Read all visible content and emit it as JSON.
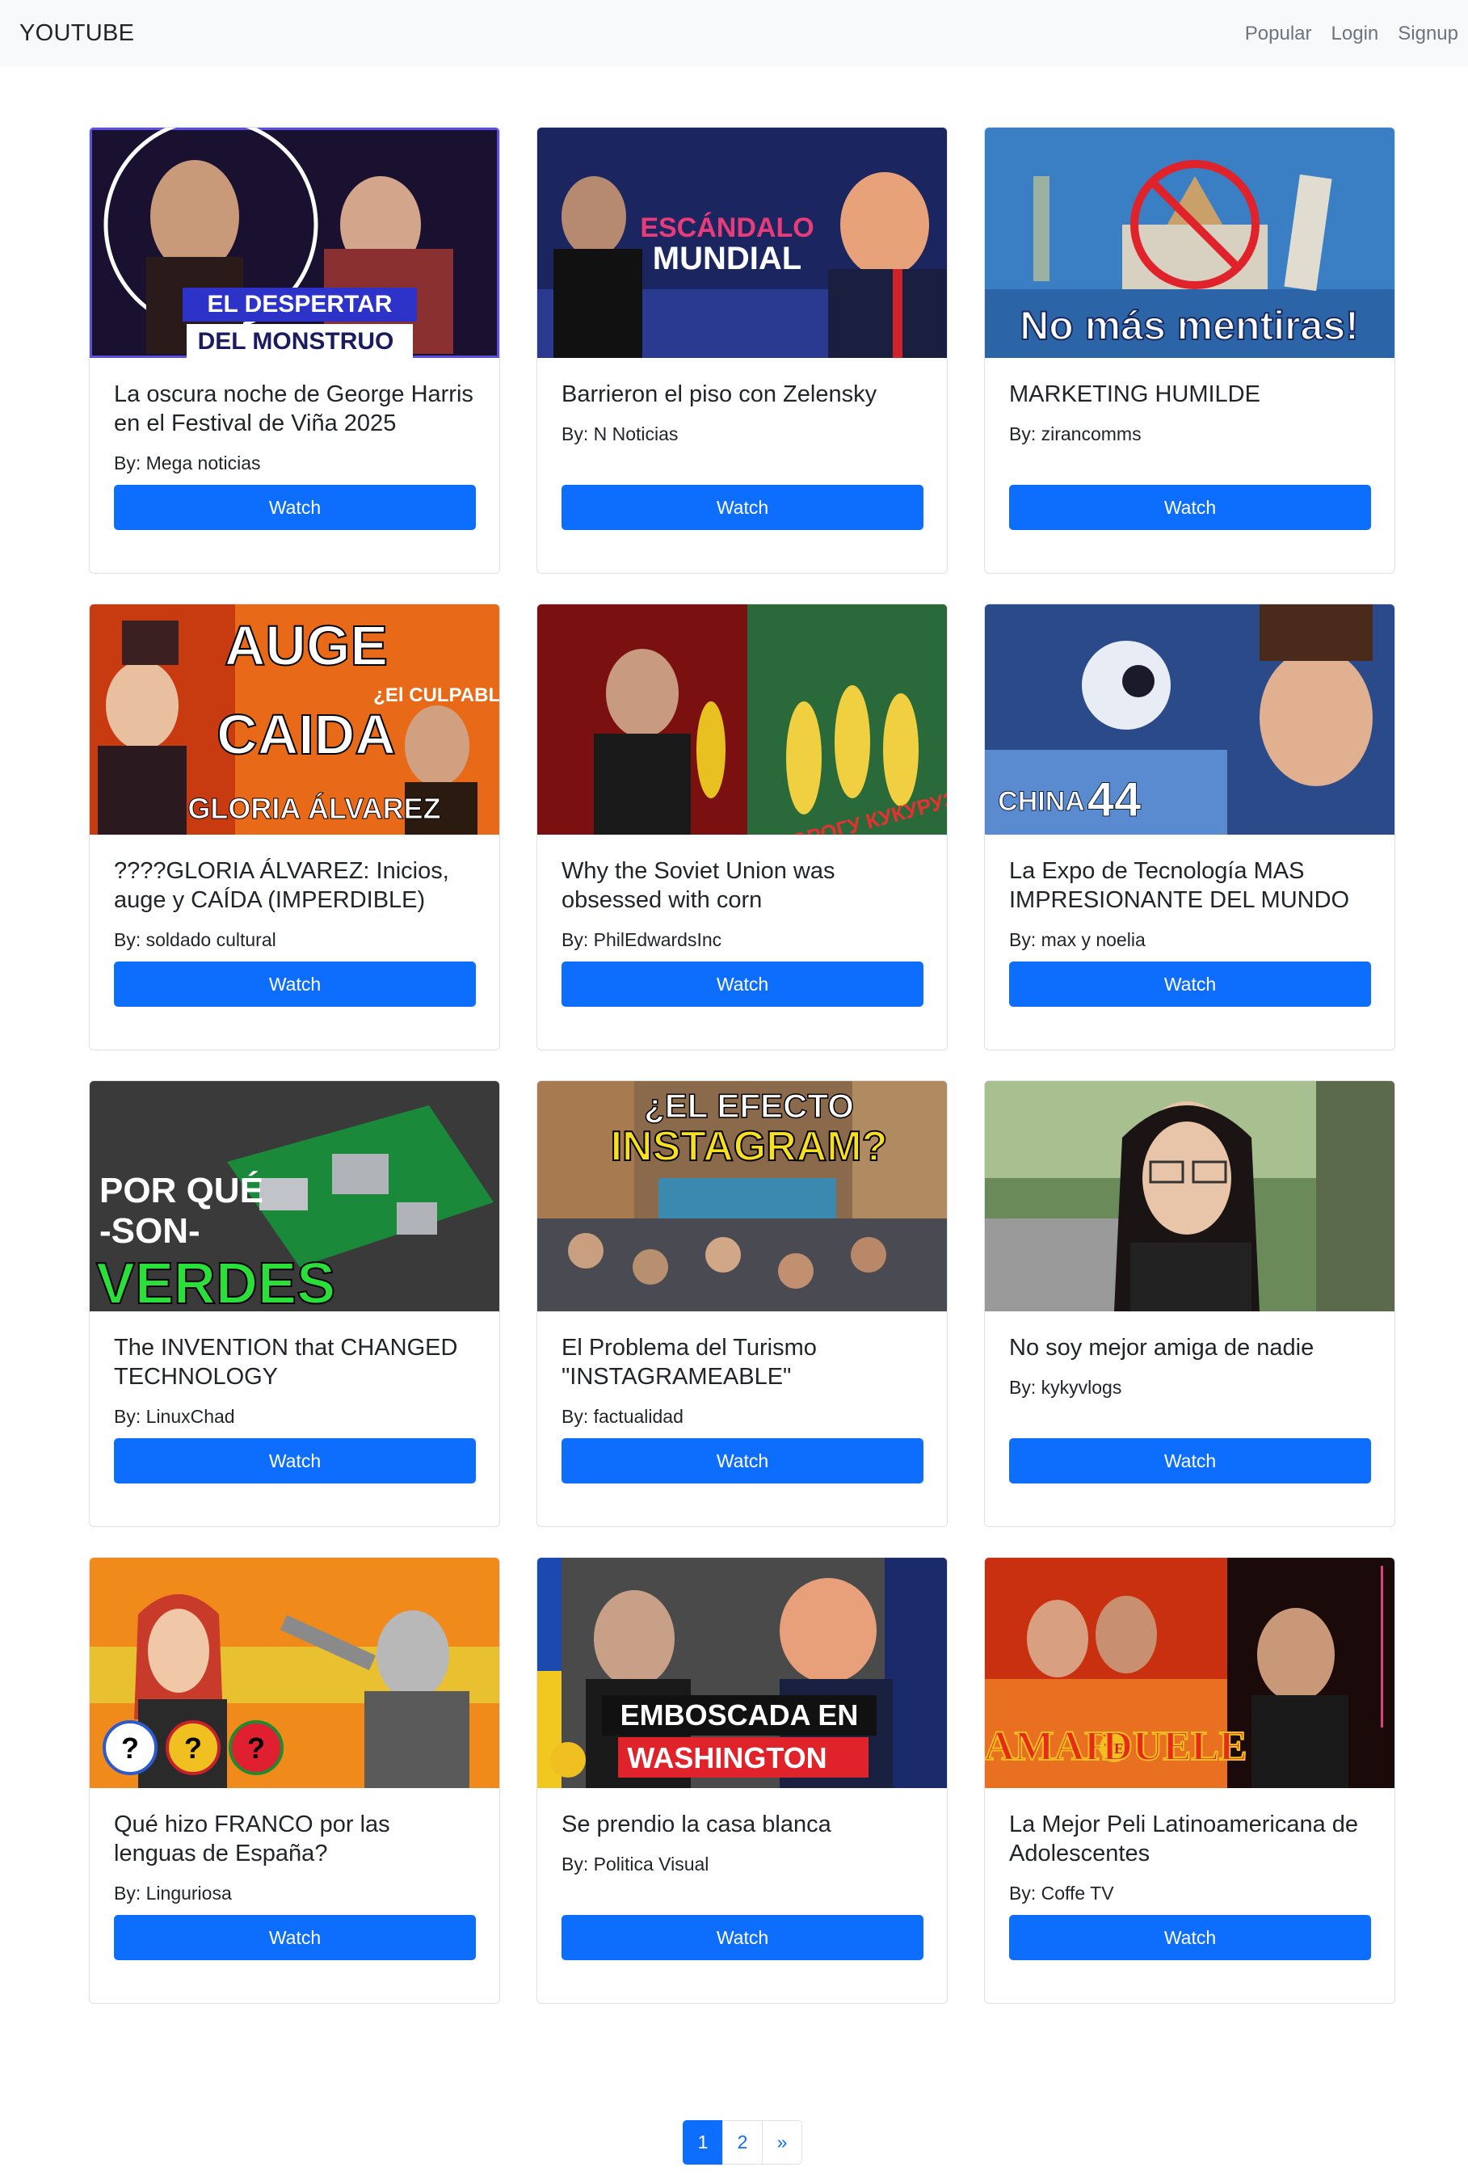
{
  "navbar": {
    "brand": "YOUTUBE",
    "links": [
      "Popular",
      "Login",
      "Signup"
    ]
  },
  "videos": [
    {
      "title": "La oscura noche de George Harris en el Festival de Viña 2025",
      "author": "By: Mega noticias",
      "watch_label": "Watch",
      "thumb_text": [
        "EL DESPERTAR",
        "DEL MONSTRUO"
      ]
    },
    {
      "title": "Barrieron el piso con Zelensky",
      "author": "By: N Noticias",
      "watch_label": "Watch",
      "thumb_text": [
        "ESCÁNDALO",
        "MUNDIAL"
      ]
    },
    {
      "title": "MARKETING HUMILDE",
      "author": "By: zirancomms",
      "watch_label": "Watch",
      "thumb_text": [
        "No más mentiras!"
      ]
    },
    {
      "title": "????GLORIA ÁLVAREZ: Inicios, auge y CAÍDA (IMPERDIBLE)",
      "author": "By: soldado cultural",
      "watch_label": "Watch",
      "thumb_text": [
        "AUGE",
        "CAIDA",
        "GLORIA ÁLVAREZ",
        "¿El CULPABLE?"
      ]
    },
    {
      "title": "Why the Soviet Union was obsessed with corn",
      "author": "By: PhilEdwardsInc",
      "watch_label": "Watch",
      "thumb_text": [
        "ДОРОГУ КУКУРУЗЕ!"
      ]
    },
    {
      "title": "La Expo de Tecnología MAS IMPRESIONANTE DEL MUNDO",
      "author": "By: max y noelia",
      "watch_label": "Watch",
      "thumb_text": [
        "CHINA",
        "44"
      ]
    },
    {
      "title": "The INVENTION that CHANGED TECHNOLOGY",
      "author": "By: LinuxChad",
      "watch_label": "Watch",
      "thumb_text": [
        "POR QUÉ",
        "-SON-",
        "VERDES"
      ]
    },
    {
      "title": "El Problema del Turismo \"INSTAGRAMEABLE\"",
      "author": "By: factualidad",
      "watch_label": "Watch",
      "thumb_text": [
        "¿EL EFECTO",
        "INSTAGRAM?"
      ]
    },
    {
      "title": "No soy mejor amiga de nadie",
      "author": "By: kykyvlogs",
      "watch_label": "Watch",
      "thumb_text": []
    },
    {
      "title": "Qué hizo FRANCO por las lenguas de España?",
      "author": "By: Linguriosa",
      "watch_label": "Watch",
      "thumb_text": [
        "?",
        "?",
        "?"
      ]
    },
    {
      "title": "Se prendio la casa blanca",
      "author": "By: Politica Visual",
      "watch_label": "Watch",
      "thumb_text": [
        "EMBOSCADA EN",
        "WASHINGTON"
      ]
    },
    {
      "title": "La Mejor Peli Latinoamericana de Adolescentes",
      "author": "By: Coffe TV",
      "watch_label": "Watch",
      "thumb_text": [
        "AMAR",
        "TE",
        "DUELE"
      ]
    }
  ],
  "pagination": {
    "pages": [
      "1",
      "2"
    ],
    "next": "»",
    "active": "1"
  },
  "colors": {
    "primary": "#0d6efd",
    "navbar_bg": "#f8f9fa",
    "nav_link": "#6c757d"
  }
}
